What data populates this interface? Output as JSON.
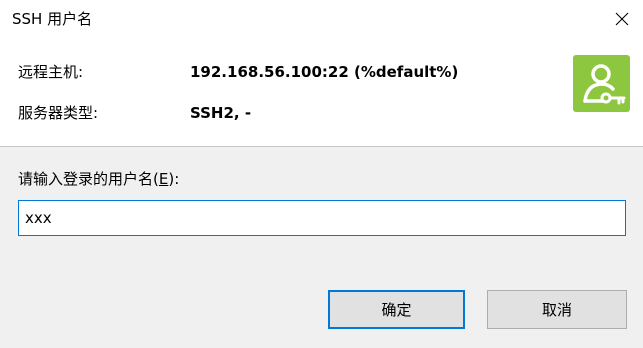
{
  "window": {
    "title": "SSH 用户名",
    "close_icon": "close-icon"
  },
  "info": {
    "remote_host_label": "远程主机:",
    "remote_host_value": "192.168.56.100:22 (%default%)",
    "server_type_label": "服务器类型:",
    "server_type_value": "SSH2, -"
  },
  "icon": {
    "name": "user-key-icon",
    "color": "#8dc63f"
  },
  "form": {
    "prompt_prefix": "请输入登录的用户名(",
    "prompt_accel": "E",
    "prompt_suffix": "):",
    "username_value": "xxx"
  },
  "buttons": {
    "ok_label": "确定",
    "cancel_label": "取消"
  },
  "colors": {
    "accent": "#0078d7",
    "footer_bg": "#f0f0f0"
  }
}
